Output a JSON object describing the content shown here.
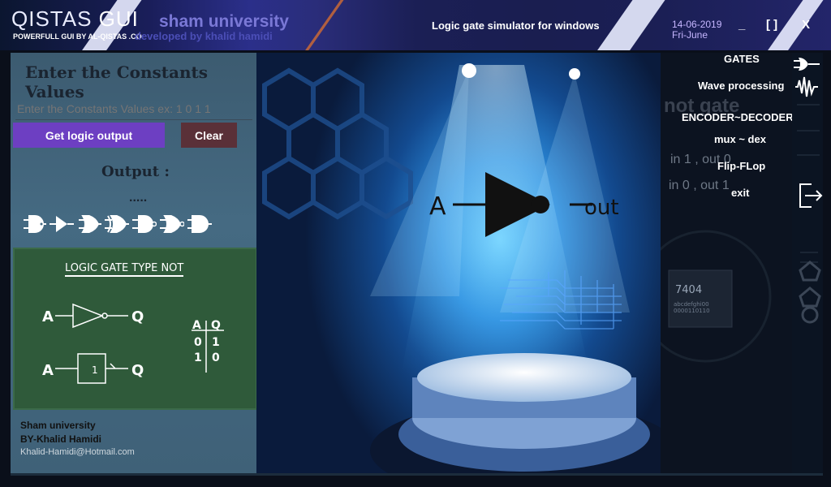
{
  "titlebar": {
    "brand_main": "QISTAS",
    "brand_gui": "GUI",
    "brand_sub": "POWERFULL GUI BY AL-QISTAS .CO",
    "university": "sham university",
    "developed_by": "developed by khalid hamidi",
    "app_title": "Logic gate simulator for windows",
    "date": "14-06-2019",
    "day": "Fri-June",
    "minimize": "_",
    "maximize": "[ ]",
    "close": "X"
  },
  "left": {
    "heading": "Enter the Constants Values",
    "input_placeholder": "Enter the Constants Values ex: 1 0 1 1",
    "get_button": "Get logic output",
    "clear_button": "Clear",
    "output_label": "Output :",
    "output_value": ".....",
    "gate_icons": [
      "and-gate-icon",
      "buffer-gate-icon",
      "or-gate-icon",
      "xor-gate-icon",
      "nand-gate-icon",
      "nor-gate-icon",
      "xnor-gate-icon"
    ],
    "board": {
      "title": "LOGIC GATE TYPE NOT",
      "input_label": "A",
      "output_label": "Q",
      "box_label": "1",
      "truth_headers": [
        "A",
        "Q"
      ],
      "truth_rows": [
        [
          "0",
          "1"
        ],
        [
          "1",
          "0"
        ]
      ]
    },
    "footer": {
      "university": "Sham university",
      "author": "BY-Khalid Hamidi",
      "email": "Khalid-Hamidi@Hotmail.com"
    }
  },
  "stage": {
    "input": "A",
    "output": "out",
    "chip_label": "7404",
    "chip_sub1": "abcdefghi00",
    "chip_sub2": "0000110110"
  },
  "nav": {
    "items": [
      "GATES",
      "Wave processing",
      "ENCODER~DECODER",
      "mux ~ dex",
      "Flip-FLop",
      "exit"
    ],
    "ghost_title": "not gate",
    "ghost_line1": "in 1 , out 0",
    "ghost_line2": "in 0 , out 1"
  },
  "colors": {
    "accent_purple": "#6d3fc2",
    "clear_btn": "#5a3038",
    "board_green": "#2f5a3a",
    "titlebar_blue": "#2b2f8a"
  }
}
